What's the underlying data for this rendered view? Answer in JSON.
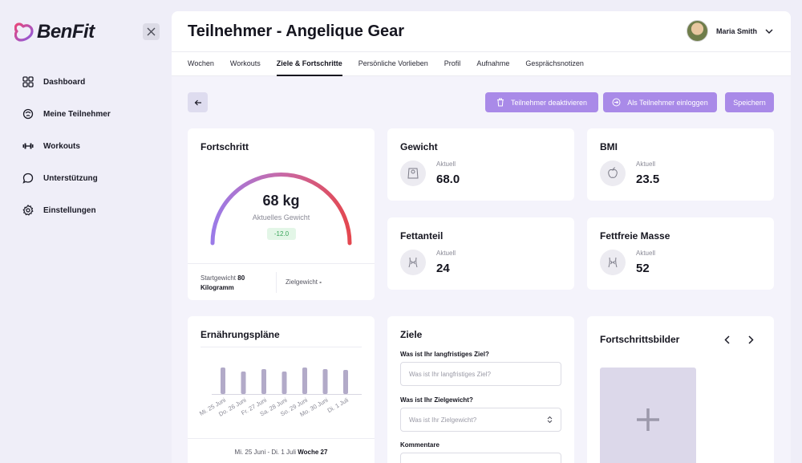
{
  "app": {
    "logo_text": "BenFit"
  },
  "sidebar": {
    "items": [
      {
        "label": "Dashboard",
        "icon": "grid-icon"
      },
      {
        "label": "Meine Teilnehmer",
        "icon": "participants-icon"
      },
      {
        "label": "Workouts",
        "icon": "dumbbell-icon"
      },
      {
        "label": "Unterstützung",
        "icon": "chat-icon"
      },
      {
        "label": "Einstellungen",
        "icon": "gear-icon"
      }
    ]
  },
  "header": {
    "title": "Teilnehmer - Angelique Gear",
    "user_name": "Maria Smith"
  },
  "tabs": [
    {
      "label": "Wochen",
      "active": false
    },
    {
      "label": "Workouts",
      "active": false
    },
    {
      "label": "Ziele & Fortschritte",
      "active": true
    },
    {
      "label": "Persönliche Vorlieben",
      "active": false
    },
    {
      "label": "Profil",
      "active": false
    },
    {
      "label": "Aufnahme",
      "active": false
    },
    {
      "label": "Gesprächsnotizen",
      "active": false
    }
  ],
  "actions": {
    "deactivate": "Teilnehmer deaktivieren",
    "login_as": "Als Teilnehmer einloggen",
    "save": "Speichern"
  },
  "progress": {
    "title": "Fortschritt",
    "value": "68 kg",
    "label": "Aktuelles Gewicht",
    "delta": "-12.0",
    "start_label": "Startgewicht",
    "start_value": "80 Kilogramm",
    "goal_label": "Zielgewicht",
    "goal_value": "-"
  },
  "metrics": {
    "weight": {
      "title": "Gewicht",
      "sub": "Aktuell",
      "value": "68.0"
    },
    "bmi": {
      "title": "BMI",
      "sub": "Aktuell",
      "value": "23.5"
    },
    "fat": {
      "title": "Fettanteil",
      "sub": "Aktuell",
      "value": "24"
    },
    "lean": {
      "title": "Fettfreie Masse",
      "sub": "Aktuell",
      "value": "52"
    }
  },
  "nutrition": {
    "title": "Ernährungspläne",
    "range": "Mi. 25 Juni - Di. 1 Juli",
    "week": "Woche 27"
  },
  "chart_data": {
    "type": "bar",
    "categories": [
      "Mi. 25 Juni",
      "Do. 26 Juni",
      "Fr. 27 Juni",
      "Sa. 28 Juni",
      "So. 29 Juni",
      "Mo. 30 Juni",
      "Di. 1 Juli"
    ],
    "values": [
      33,
      28,
      31,
      28,
      33,
      31,
      30
    ],
    "title": "",
    "colors": {
      "bar": "#b2aac8"
    }
  },
  "goals": {
    "title": "Ziele",
    "q1": "Was ist Ihr langfristiges Ziel?",
    "q1_placeholder": "Was ist Ihr langfristiges Ziel?",
    "q2": "Was ist Ihr Zielgewicht?",
    "q2_placeholder": "Was ist Ihr Zielgewicht?",
    "q3": "Kommentare"
  },
  "photos": {
    "title": "Fortschrittsbilder"
  }
}
